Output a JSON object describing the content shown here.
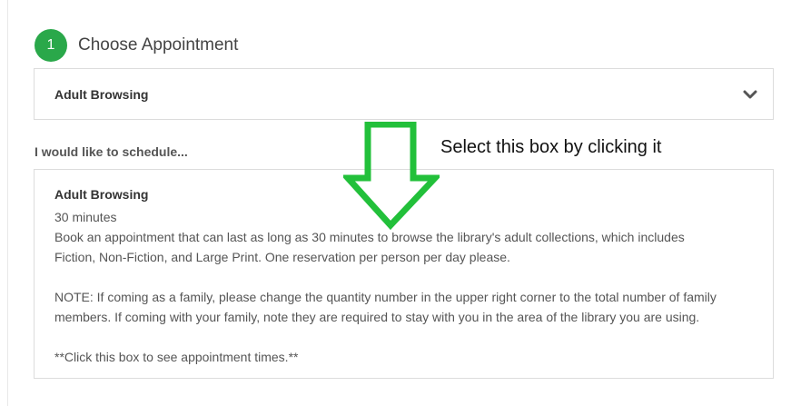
{
  "step": {
    "number": "1",
    "title": "Choose Appointment"
  },
  "appointment_select": {
    "selected_value": "Adult Browsing",
    "icon": "chevron-down-icon"
  },
  "schedule": {
    "label": "I would like to schedule..."
  },
  "appointment_card": {
    "title": "Adult Browsing",
    "duration": "30 minutes",
    "description_line1": "Book an appointment that can last as long as 30 minutes to browse the library's adult collections, which includes",
    "description_line2": "Fiction, Non-Fiction, and Large Print. One reservation per person per day please.",
    "note_line1": "NOTE: If coming as a family, please change the quantity number in the upper right corner to the total number of family",
    "note_line2": "members. If coming with your family, note they are required to stay with you in the area of the library you are using.",
    "cta": "**Click this box to see appointment times.**"
  },
  "annotation": {
    "text": "Select this box by clicking it",
    "arrow_icon": "down-arrow-icon",
    "arrow_color": "#22c03a"
  },
  "colors": {
    "step_badge": "#2aa84a",
    "border": "#dcdcdc"
  }
}
